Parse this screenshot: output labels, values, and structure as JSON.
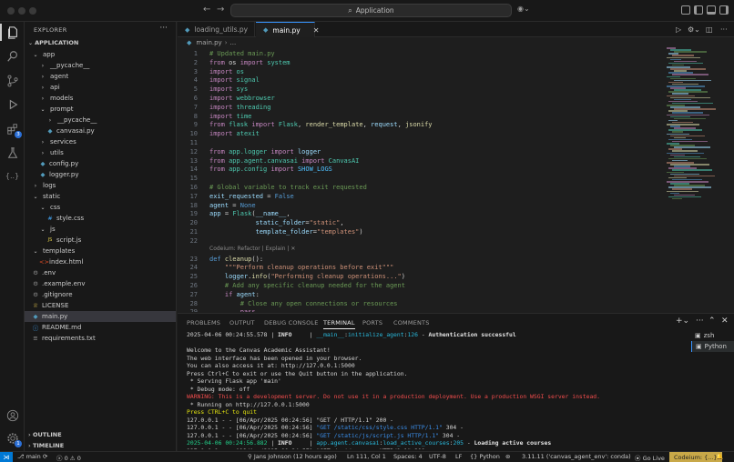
{
  "titlebar": {
    "command_center": "Application"
  },
  "activity": {
    "extensions_badge": "3",
    "account_badge": "1"
  },
  "sidebar": {
    "title": "EXPLORER",
    "root": "APPLICATION",
    "tree": [
      {
        "label": "app",
        "depth": 0,
        "kind": "folder-open"
      },
      {
        "label": "__pycache__",
        "depth": 1,
        "kind": "folder"
      },
      {
        "label": "agent",
        "depth": 1,
        "kind": "folder"
      },
      {
        "label": "api",
        "depth": 1,
        "kind": "folder"
      },
      {
        "label": "models",
        "depth": 1,
        "kind": "folder"
      },
      {
        "label": "prompt",
        "depth": 1,
        "kind": "folder-open"
      },
      {
        "label": "__pycache__",
        "depth": 2,
        "kind": "folder"
      },
      {
        "label": "canvasai.py",
        "depth": 2,
        "kind": "py"
      },
      {
        "label": "services",
        "depth": 1,
        "kind": "folder"
      },
      {
        "label": "utils",
        "depth": 1,
        "kind": "folder"
      },
      {
        "label": "config.py",
        "depth": 1,
        "kind": "py"
      },
      {
        "label": "logger.py",
        "depth": 1,
        "kind": "py"
      },
      {
        "label": "logs",
        "depth": 0,
        "kind": "folder"
      },
      {
        "label": "static",
        "depth": 0,
        "kind": "folder-open"
      },
      {
        "label": "css",
        "depth": 1,
        "kind": "folder-open"
      },
      {
        "label": "style.css",
        "depth": 2,
        "kind": "css"
      },
      {
        "label": "js",
        "depth": 1,
        "kind": "folder-open"
      },
      {
        "label": "script.js",
        "depth": 2,
        "kind": "js"
      },
      {
        "label": "templates",
        "depth": 0,
        "kind": "folder-open"
      },
      {
        "label": "index.html",
        "depth": 1,
        "kind": "html"
      },
      {
        "label": ".env",
        "depth": 0,
        "kind": "env"
      },
      {
        "label": ".example.env",
        "depth": 0,
        "kind": "env"
      },
      {
        "label": ".gitignore",
        "depth": 0,
        "kind": "env"
      },
      {
        "label": "LICENSE",
        "depth": 0,
        "kind": "license"
      },
      {
        "label": "main.py",
        "depth": 0,
        "kind": "py",
        "selected": true
      },
      {
        "label": "README.md",
        "depth": 0,
        "kind": "md"
      },
      {
        "label": "requirements.txt",
        "depth": 0,
        "kind": "txt"
      }
    ],
    "outline": "OUTLINE",
    "timeline": "TIMELINE"
  },
  "tabs": [
    {
      "label": "loading_utils.py",
      "active": false
    },
    {
      "label": "main.py",
      "active": true
    }
  ],
  "breadcrumb": {
    "file": "main.py",
    "rest": "..."
  },
  "code_lens": "Codeium: Refactor | Explain | ✕",
  "code": [
    {
      "n": "1",
      "tokens": [
        [
          "c",
          "# Updated main.py"
        ]
      ]
    },
    {
      "n": "2",
      "tokens": [
        [
          "k",
          "from"
        ],
        [
          "n",
          " os "
        ],
        [
          "k",
          "import"
        ],
        [
          "n",
          " "
        ],
        [
          "t",
          "system"
        ]
      ]
    },
    {
      "n": "3",
      "tokens": [
        [
          "k",
          "import"
        ],
        [
          "n",
          " "
        ],
        [
          "t",
          "os"
        ]
      ]
    },
    {
      "n": "4",
      "tokens": [
        [
          "k",
          "import"
        ],
        [
          "n",
          " "
        ],
        [
          "t",
          "signal"
        ]
      ]
    },
    {
      "n": "5",
      "tokens": [
        [
          "k",
          "import"
        ],
        [
          "n",
          " "
        ],
        [
          "t",
          "sys"
        ]
      ]
    },
    {
      "n": "6",
      "tokens": [
        [
          "k",
          "import"
        ],
        [
          "n",
          " "
        ],
        [
          "t",
          "webbrowser"
        ]
      ]
    },
    {
      "n": "7",
      "tokens": [
        [
          "k",
          "import"
        ],
        [
          "n",
          " "
        ],
        [
          "t",
          "threading"
        ]
      ]
    },
    {
      "n": "8",
      "tokens": [
        [
          "k",
          "import"
        ],
        [
          "n",
          " "
        ],
        [
          "t",
          "time"
        ]
      ]
    },
    {
      "n": "9",
      "tokens": [
        [
          "k",
          "from"
        ],
        [
          "n",
          " "
        ],
        [
          "t",
          "flask"
        ],
        [
          "n",
          " "
        ],
        [
          "k",
          "import"
        ],
        [
          "n",
          " "
        ],
        [
          "t",
          "Flask"
        ],
        [
          "n",
          ", "
        ],
        [
          "fn",
          "render_template"
        ],
        [
          "n",
          ", "
        ],
        [
          "v",
          "request"
        ],
        [
          "n",
          ", "
        ],
        [
          "fn",
          "jsonify"
        ]
      ]
    },
    {
      "n": "10",
      "tokens": [
        [
          "k",
          "import"
        ],
        [
          "n",
          " "
        ],
        [
          "t",
          "atexit"
        ]
      ]
    },
    {
      "n": "11",
      "tokens": []
    },
    {
      "n": "12",
      "tokens": [
        [
          "k",
          "from"
        ],
        [
          "n",
          " "
        ],
        [
          "t",
          "app.logger"
        ],
        [
          "n",
          " "
        ],
        [
          "k",
          "import"
        ],
        [
          "n",
          " "
        ],
        [
          "v",
          "logger"
        ]
      ]
    },
    {
      "n": "13",
      "tokens": [
        [
          "k",
          "from"
        ],
        [
          "n",
          " "
        ],
        [
          "t",
          "app.agent.canvasai"
        ],
        [
          "n",
          " "
        ],
        [
          "k",
          "import"
        ],
        [
          "n",
          " "
        ],
        [
          "t",
          "CanvasAI"
        ]
      ]
    },
    {
      "n": "14",
      "tokens": [
        [
          "k",
          "from"
        ],
        [
          "n",
          " "
        ],
        [
          "t",
          "app.config"
        ],
        [
          "n",
          " "
        ],
        [
          "k",
          "import"
        ],
        [
          "n",
          " "
        ],
        [
          "cn",
          "SHOW_LOGS"
        ]
      ]
    },
    {
      "n": "15",
      "tokens": []
    },
    {
      "n": "16",
      "tokens": [
        [
          "c",
          "# Global variable to track exit requested"
        ]
      ]
    },
    {
      "n": "17",
      "tokens": [
        [
          "v",
          "exit_requested"
        ],
        [
          "n",
          " = "
        ],
        [
          "kw",
          "False"
        ]
      ]
    },
    {
      "n": "18",
      "tokens": [
        [
          "v",
          "agent"
        ],
        [
          "n",
          " = "
        ],
        [
          "kw",
          "None"
        ]
      ]
    },
    {
      "n": "19",
      "tokens": [
        [
          "v",
          "app"
        ],
        [
          "n",
          " = "
        ],
        [
          "t",
          "Flask"
        ],
        [
          "n",
          "("
        ],
        [
          "v",
          "__name__"
        ],
        [
          "n",
          ","
        ]
      ]
    },
    {
      "n": "20",
      "tokens": [
        [
          "n",
          "            "
        ],
        [
          "v",
          "static_folder"
        ],
        [
          "n",
          "="
        ],
        [
          "s",
          "\"static\""
        ],
        [
          "n",
          ","
        ]
      ]
    },
    {
      "n": "21",
      "tokens": [
        [
          "n",
          "            "
        ],
        [
          "v",
          "template_folder"
        ],
        [
          "n",
          "="
        ],
        [
          "s",
          "\"templates\""
        ],
        [
          "n",
          ")"
        ]
      ]
    },
    {
      "n": "22",
      "tokens": []
    },
    {
      "n": "23",
      "tokens": [
        [
          "kw",
          "def"
        ],
        [
          "n",
          " "
        ],
        [
          "fn",
          "cleanup"
        ],
        [
          "n",
          "():"
        ]
      ]
    },
    {
      "n": "24",
      "tokens": [
        [
          "n",
          "    "
        ],
        [
          "s",
          "\"\"\"Perform cleanup operations before exit\"\"\""
        ]
      ]
    },
    {
      "n": "25",
      "tokens": [
        [
          "n",
          "    "
        ],
        [
          "v",
          "logger"
        ],
        [
          "n",
          "."
        ],
        [
          "fn",
          "info"
        ],
        [
          "n",
          "("
        ],
        [
          "s",
          "\"Performing cleanup operations...\""
        ],
        [
          "n",
          ")"
        ]
      ]
    },
    {
      "n": "26",
      "tokens": [
        [
          "n",
          "    "
        ],
        [
          "c",
          "# Add any specific cleanup needed for the agent"
        ]
      ]
    },
    {
      "n": "27",
      "tokens": [
        [
          "n",
          "    "
        ],
        [
          "k",
          "if"
        ],
        [
          "n",
          " "
        ],
        [
          "v",
          "agent"
        ],
        [
          "n",
          ":"
        ]
      ]
    },
    {
      "n": "28",
      "tokens": [
        [
          "n",
          "        "
        ],
        [
          "c",
          "# Close any open connections or resources"
        ]
      ]
    },
    {
      "n": "29",
      "tokens": [
        [
          "n",
          "        "
        ],
        [
          "k",
          "pass"
        ]
      ]
    }
  ],
  "panel": {
    "tabs": [
      "PROBLEMS",
      "OUTPUT",
      "DEBUG CONSOLE",
      "TERMINAL",
      "PORTS",
      "COMMENTS"
    ],
    "active_tab": "TERMINAL",
    "terminals": [
      "zsh",
      "Python"
    ],
    "output": [
      [
        [
          "n",
          "2025-04-06 00:24:55.578 | "
        ],
        [
          "bold",
          "INFO"
        ],
        [
          "n",
          "     | "
        ],
        [
          "cy",
          "__main__"
        ],
        [
          "n",
          ":"
        ],
        [
          "cy",
          "initialize_agent"
        ],
        [
          "n",
          ":"
        ],
        [
          "cy",
          "126"
        ],
        [
          "n",
          " - "
        ],
        [
          "bold",
          "Authentication successful"
        ]
      ],
      [],
      [
        [
          "n",
          "Welcome to the Canvas Academic Assistant!"
        ]
      ],
      [
        [
          "n",
          "The web interface has been opened in your browser."
        ]
      ],
      [
        [
          "n",
          "You can also access it at: http://127.0.0.1:5000"
        ]
      ],
      [
        [
          "n",
          "Press Ctrl+C to exit or use the Quit button in the application."
        ]
      ],
      [
        [
          "n",
          " * Serving Flask app 'main'"
        ]
      ],
      [
        [
          "n",
          " * Debug mode: off"
        ]
      ],
      [
        [
          "r",
          "WARNING: This is a development server. Do not use it in a production deployment. Use a production WSGI server instead."
        ]
      ],
      [
        [
          "n",
          " * Running on http://127.0.0.1:5000"
        ]
      ],
      [
        [
          "y",
          "Press CTRL+C to quit"
        ]
      ],
      [
        [
          "n",
          "127.0.0.1 - - [06/Apr/2025 00:24:56] \"GET / HTTP/1.1\" 200 -"
        ]
      ],
      [
        [
          "n",
          "127.0.0.1 - - [06/Apr/2025 00:24:56] "
        ],
        [
          "b",
          "\"GET /static/css/style.css HTTP/1.1\""
        ],
        [
          "n",
          " 304 -"
        ]
      ],
      [
        [
          "n",
          "127.0.0.1 - - [06/Apr/2025 00:24:56] "
        ],
        [
          "b",
          "\"GET /static/js/script.js HTTP/1.1\""
        ],
        [
          "n",
          " 304 -"
        ]
      ],
      [
        [
          "g",
          "2025-04-06 00:24:56.882"
        ],
        [
          "n",
          " | "
        ],
        [
          "bold",
          "INFO"
        ],
        [
          "n",
          "     | "
        ],
        [
          "cy",
          "app.agent.canvasai"
        ],
        [
          "n",
          ":"
        ],
        [
          "cy",
          "load_active_courses"
        ],
        [
          "n",
          ":"
        ],
        [
          "cy",
          "205"
        ],
        [
          "n",
          " - "
        ],
        [
          "bold",
          "Loading active courses"
        ]
      ],
      [
        [
          "n",
          "127.0.0.1 - - [06/Apr/2025 00:24:57] \"GET /api/courses HTTP/1.1\" 200 -"
        ]
      ]
    ]
  },
  "status": {
    "branch": "main",
    "problems": "0",
    "warnings": "0",
    "blame": "Jans Johnson (12 hours ago)",
    "position": "Ln 111, Col 1",
    "spaces": "Spaces: 4",
    "encoding": "UTF-8",
    "eol": "LF",
    "language": "Python",
    "interpreter": "3.11.11 ('canvas_agent_env': conda)",
    "golive": "Go Live",
    "codeium": "Codeium: {...}"
  },
  "colors": {
    "accent": "#0078d4",
    "codeium": "#c8a848",
    "tab_active_border": "#3794ff"
  }
}
